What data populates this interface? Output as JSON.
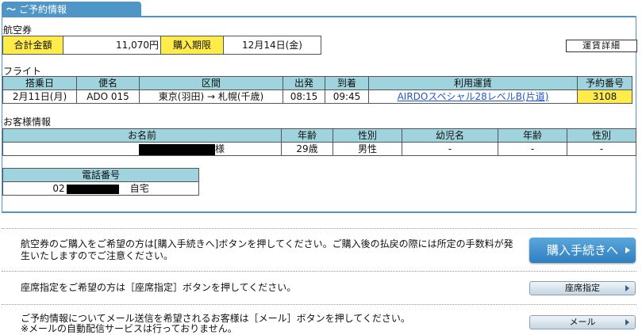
{
  "section_tab": {
    "title": "ご予約情報"
  },
  "ticket": {
    "heading": "航空券",
    "total_label": "合計金額",
    "total_value": "11,070円",
    "deadline_label": "購入期限",
    "deadline_value": "12月14日(金)",
    "fare_detail_button": "運賃詳細"
  },
  "flight": {
    "heading": "フライト",
    "columns": [
      "搭乗日",
      "便名",
      "区間",
      "出発",
      "到着",
      "利用運賃",
      "予約番号"
    ],
    "row": {
      "date": "2月11日(月)",
      "flight_no": "ADO 015",
      "route": "東京(羽田) → 札幌(千歳)",
      "departure": "08:15",
      "arrival": "09:45",
      "fare": "AIRDOスペシャル28レベルB(片道)",
      "reservation_no": "3108"
    }
  },
  "customer": {
    "heading": "お客様情報",
    "columns": [
      "お名前",
      "年齢",
      "性別",
      "幼児名",
      "年齢",
      "性別"
    ],
    "row": {
      "name_suffix": "様",
      "age": "29歳",
      "gender": "男性",
      "infant_name": "-",
      "infant_age": "-",
      "infant_gender": "-"
    },
    "phone_label": "電話番号",
    "phone_prefix": "02",
    "phone_type": "自宅"
  },
  "actions": [
    {
      "message": "航空券のご購入をご希望の方は[購入手続きへ]ボタンを押してください。ご購入後の払戻の際には所定の手数料が発生いたしますのでご注意ください。",
      "button": "購入手続きへ"
    },
    {
      "message": "座席指定をご希望の方は［座席指定］ボタンを押してください。",
      "button": "座席指定"
    },
    {
      "message_line1": "ご予約情報についてメール送信を希望されるお客様は［メール］ボタンを押してください。",
      "message_line2": "※メールの自動配信サービスは行っておりません。",
      "button": "メール"
    }
  ],
  "colors": {
    "accent_blue": "#4f95c6",
    "header_cyan": "#9fd3dd",
    "highlight_yellow": "#ffec4a",
    "link": "#2255cc"
  }
}
